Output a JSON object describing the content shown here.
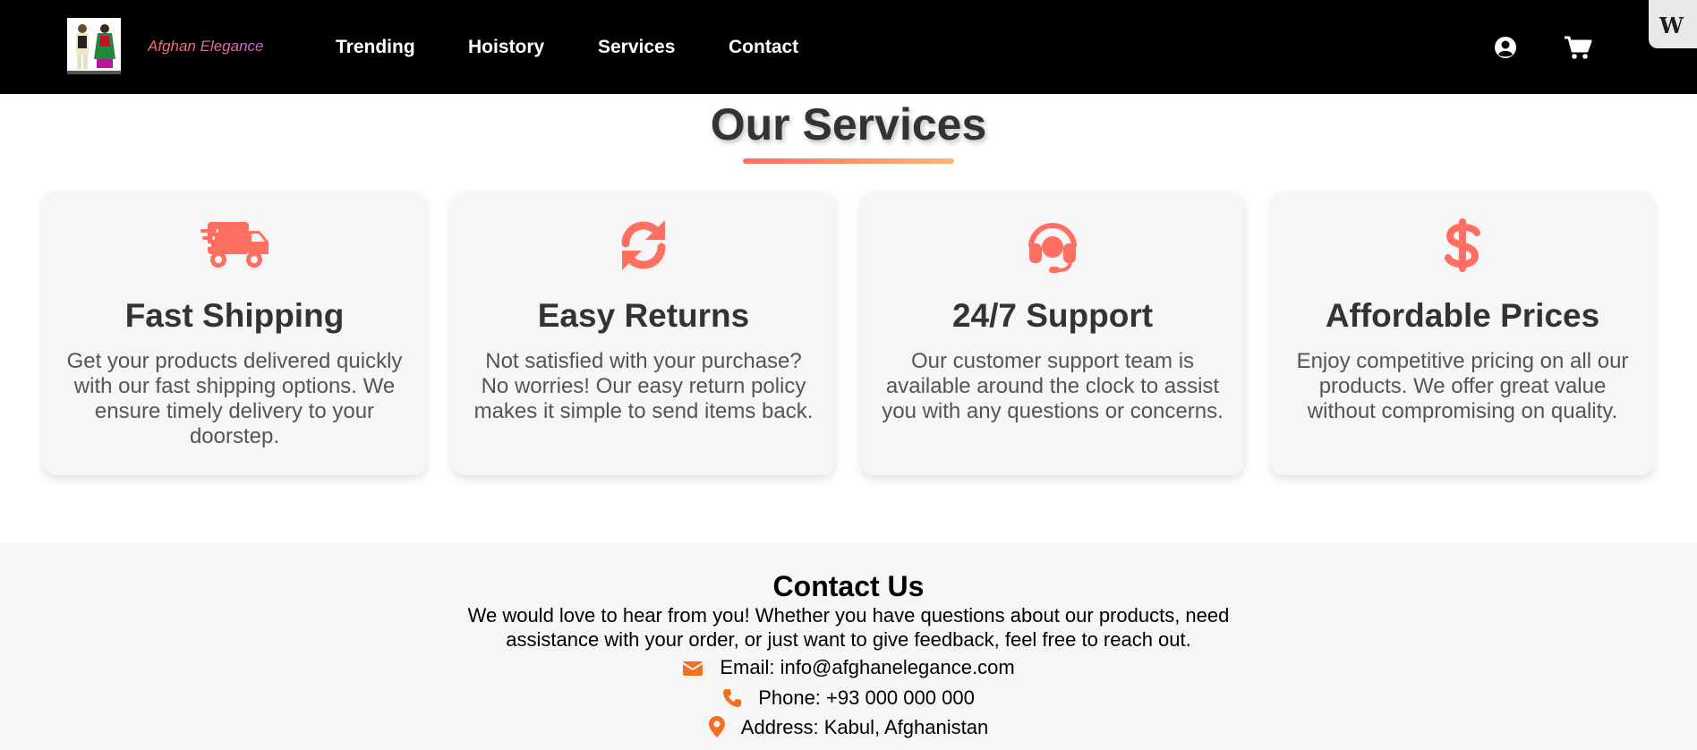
{
  "colors": {
    "accent": "#ff6f61",
    "accent_end": "#feb47b",
    "contact_icon": "#f36f21",
    "nav_bg": "#000000"
  },
  "navbar": {
    "brand": "Afghan Elegance",
    "links": [
      "Trending",
      "Hoistory",
      "Services",
      "Contact"
    ],
    "icons": [
      "user-circle-icon",
      "shopping-cart-icon"
    ],
    "badge": "W"
  },
  "services": {
    "title": "Our Services",
    "cards": [
      {
        "icon": "truck-fast-icon",
        "title": "Fast Shipping",
        "text": "Get your products delivered quickly with our fast shipping options. We ensure timely delivery to your doorstep."
      },
      {
        "icon": "sync-icon",
        "title": "Easy Returns",
        "text": "Not satisfied with your purchase? No worries! Our easy return policy makes it simple to send items back."
      },
      {
        "icon": "headset-icon",
        "title": "24/7 Support",
        "text": "Our customer support team is available around the clock to assist you with any questions or concerns."
      },
      {
        "icon": "dollar-sign-icon",
        "title": "Affordable Prices",
        "text": "Enjoy competitive pricing on all our products. We offer great value without compromising on quality."
      }
    ]
  },
  "contact": {
    "title": "Contact Us",
    "text": "We would love to hear from you! Whether you have questions about our products, need assistance with your order, or just want to give feedback, feel free to reach out.",
    "email": "Email: info@afghanelegance.com",
    "phone": "Phone: +93 000 000 000",
    "address": "Address: Kabul, Afghanistan"
  }
}
